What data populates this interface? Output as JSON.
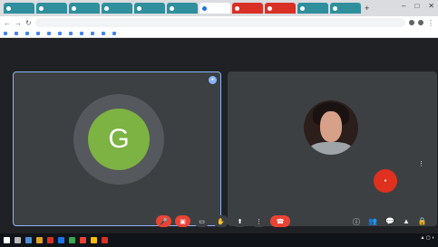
{
  "browser": {
    "tabs": [
      {
        "label": "",
        "state": "normal"
      },
      {
        "label": "",
        "state": "normal"
      },
      {
        "label": "",
        "state": "normal"
      },
      {
        "label": "",
        "state": "normal"
      },
      {
        "label": "",
        "state": "normal"
      },
      {
        "label": "",
        "state": "normal"
      },
      {
        "label": "",
        "state": "active"
      },
      {
        "label": "",
        "state": "red"
      },
      {
        "label": "",
        "state": "red"
      },
      {
        "label": "",
        "state": "normal"
      },
      {
        "label": "",
        "state": "normal"
      }
    ],
    "url": "",
    "bookmarks": [
      "",
      "",
      "",
      "",
      "",
      "",
      "",
      "",
      "",
      "",
      ""
    ]
  },
  "meet": {
    "self_tile": {
      "avatar_letter": "G",
      "name": ""
    },
    "remote_tile": {
      "name": ""
    },
    "mini_tile": {
      "name": ""
    },
    "meeting_info": ""
  },
  "colors": {
    "stage": "#202124",
    "tile": "#3c4043",
    "avatar_green": "#7cb342",
    "end_call_red": "#ea4335",
    "tab_teal": "#2f8f9d"
  },
  "icons": {
    "controls": [
      "mic-off-icon",
      "camera-off-icon",
      "captions-icon",
      "hand-icon",
      "present-icon",
      "more-icon",
      "end-call-icon"
    ],
    "right_controls": [
      "info-icon",
      "people-icon",
      "chat-icon",
      "activities-icon",
      "lock-icon"
    ]
  }
}
